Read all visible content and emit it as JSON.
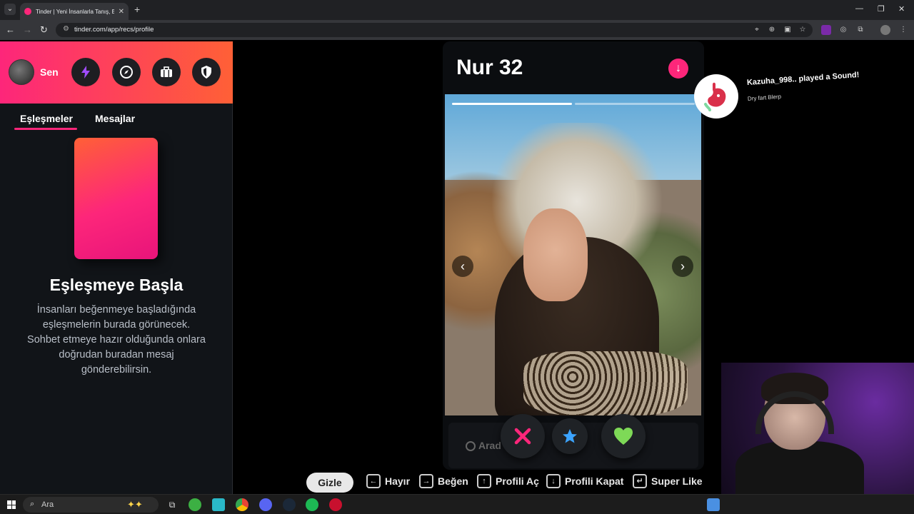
{
  "browser": {
    "tab_title": "Tinder | Yeni İnsanlarla Tanış, Bu",
    "url": "tinder.com/app/recs/profile"
  },
  "sidebar": {
    "user_label": "Sen",
    "tabs": [
      {
        "label": "Eşleşmeler",
        "active": true
      },
      {
        "label": "Mesajlar",
        "active": false
      }
    ],
    "empty_title": "Eşleşmeye Başla",
    "empty_description": "İnsanları beğenmeye başladığında eşleşmelerin burada görünecek. Sohbet etmeye hazır olduğunda onlara doğrudan buradan mesaj gönderebilirsin."
  },
  "profile": {
    "name_age": "Nur 32",
    "search_placeholder": "Arad",
    "photo_count": 2,
    "current_photo": 1
  },
  "notification": {
    "title": "Kazuha_998.. played a Sound!",
    "subtitle": "Dry fart Blerp"
  },
  "shortcuts": {
    "hide_label": "Gizle",
    "items": [
      {
        "key": "←",
        "label": "Hayır"
      },
      {
        "key": "→",
        "label": "Beğen"
      },
      {
        "key": "↑",
        "label": "Profili Aç"
      },
      {
        "key": "↓",
        "label": "Profili Kapat"
      },
      {
        "key": "↵",
        "label": "Super Like"
      }
    ]
  },
  "taskbar": {
    "search_label": "Ara"
  },
  "colors": {
    "brand_pink": "#fd267a",
    "brand_orange": "#ff6036",
    "like_green": "#7ed957",
    "superlike_blue": "#3ca4ff"
  }
}
